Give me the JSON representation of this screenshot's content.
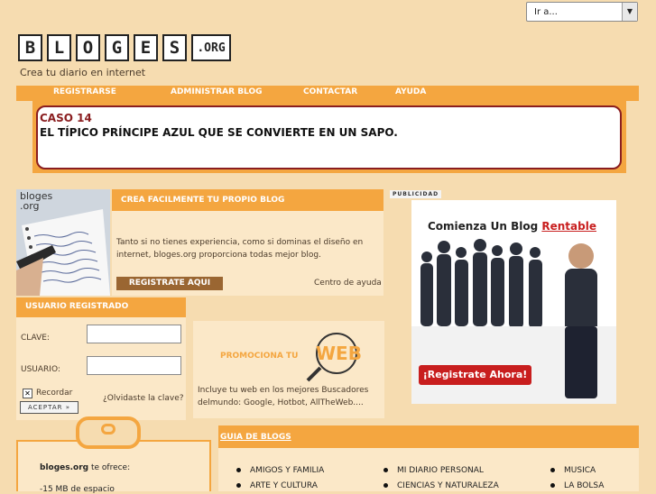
{
  "goto_select": {
    "value": "Ir a..."
  },
  "logo": {
    "letters": [
      "B",
      "L",
      "O",
      "G",
      "E",
      "S"
    ],
    "org": ".ORG"
  },
  "tagline": "Crea tu diario en internet",
  "nav": {
    "items": [
      "REGISTRARSE",
      "ADMINISTRAR BLOG",
      "CONTACTAR",
      "AYUDA"
    ]
  },
  "banner": {
    "case": "CASO 14",
    "text": "EL TÍPICO PRÍNCIPE AZUL QUE SE CONVIERTE EN UN SAPO."
  },
  "photo_caption": "bloges\n.org",
  "create": {
    "heading": "CREA FACILMENTE TU PROPIO BLOG",
    "text": "Tanto si no tienes experiencia, como si dominas el diseño en internet, bloges.org proporciona todas mejor blog.",
    "button": "REGISTRATE AQUI",
    "help": "Centro de ayuda"
  },
  "login": {
    "heading": "USUARIO REGISTRADO",
    "clave_label": "CLAVE:",
    "usuario_label": "USUARIO:",
    "remember": "Recordar",
    "forgot": "¿Olvidaste la clave?",
    "accept": "ACEPTAR »"
  },
  "promo": {
    "title": "PROMOCIONA TU",
    "web": "WEB",
    "text": "Incluye tu web en los mejores Buscadores delmundo: Google, Hotbot, AllTheWeb...."
  },
  "ad": {
    "label": "PUBLICIDAD",
    "title": "Comienza Un Blog",
    "title_highlight": "Rentable",
    "cta": "¡Registrate Ahora!"
  },
  "offer": {
    "brand": "bloges.org",
    "rest": " te ofrece:",
    "item1": "-15 MB de espacio"
  },
  "guide": {
    "heading": "GUIA DE BLOGS",
    "col1": [
      "AMIGOS Y FAMILIA",
      "ARTE Y CULTURA"
    ],
    "col2": [
      "MI DIARIO PERSONAL",
      "CIENCIAS Y NATURALEZA"
    ],
    "col3": [
      "MUSICA",
      "LA BOLSA"
    ]
  },
  "colors": {
    "accent": "#f4a640",
    "panel": "#fbe8c8",
    "background": "#f6dcb0",
    "banner_border": "#8a1e20",
    "button_brown": "#9a6632",
    "ad_red": "#c81e1e"
  }
}
